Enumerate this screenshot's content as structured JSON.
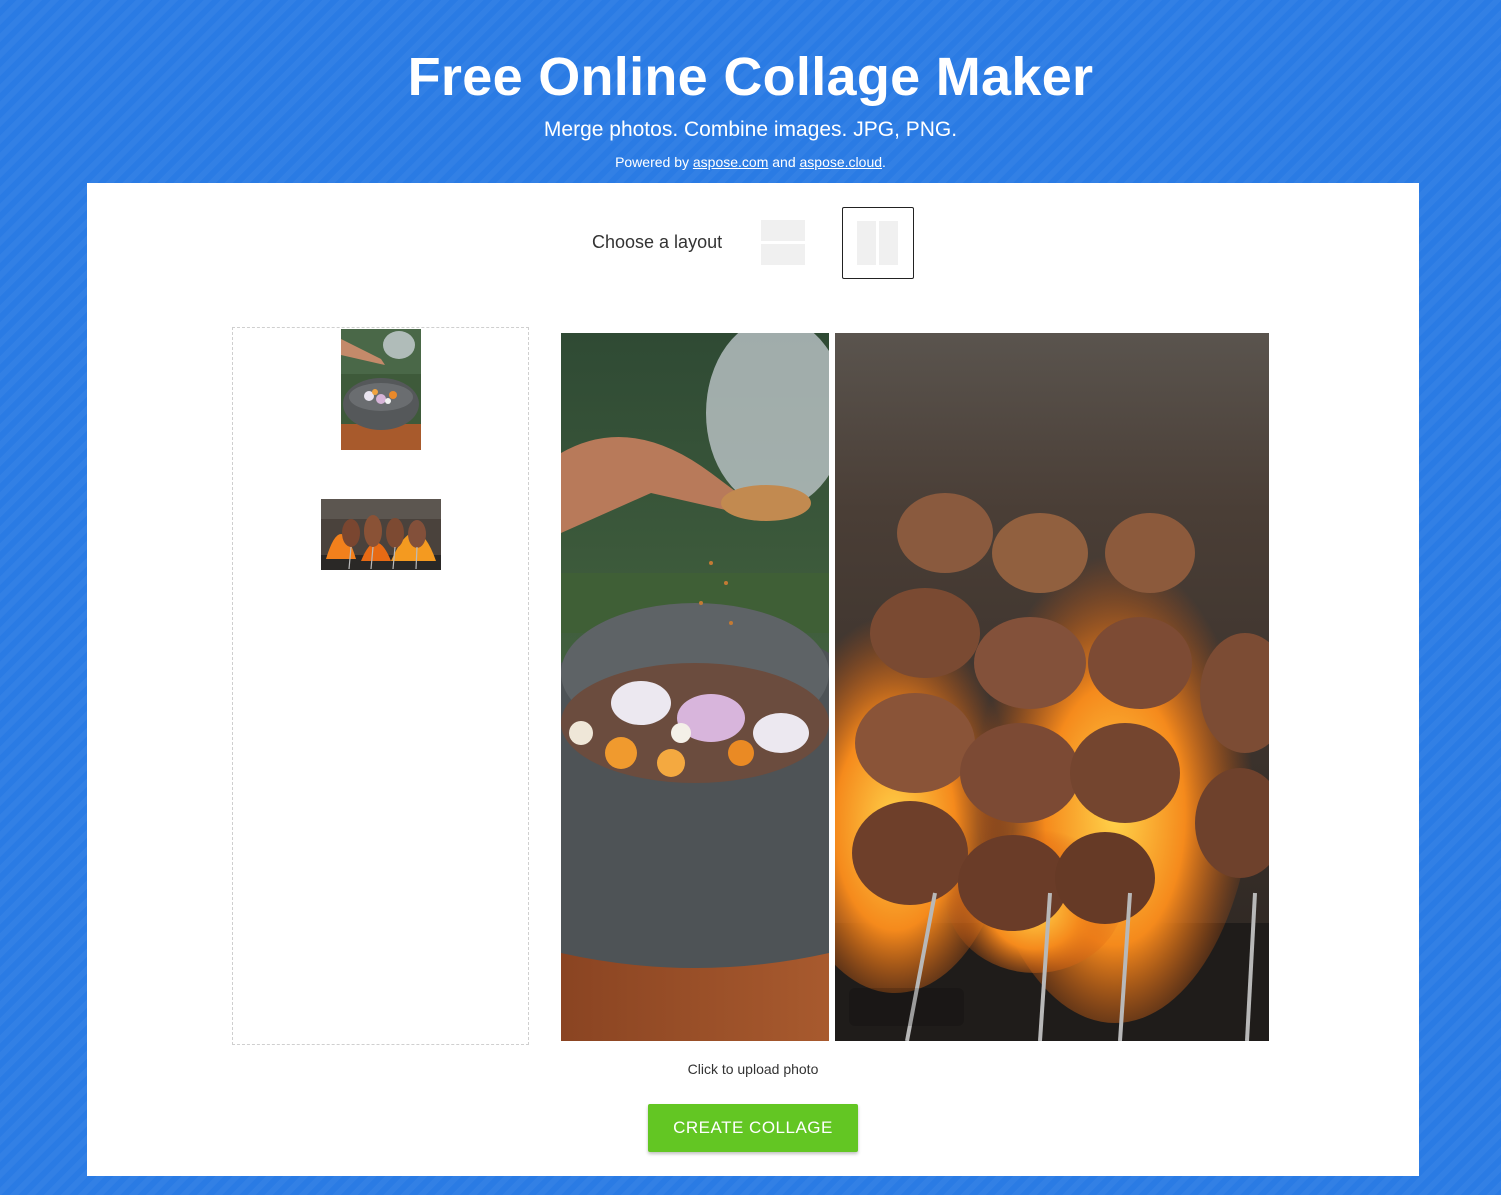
{
  "header": {
    "title": "Free Online Collage Maker",
    "subtitle": "Merge photos. Combine images. JPG, PNG.",
    "powered_prefix": "Powered by",
    "link1": "aspose.com",
    "and": "and",
    "link2": "aspose.cloud",
    "period": "."
  },
  "layout": {
    "label": "Choose a layout",
    "selected": "two-columns"
  },
  "thumbnails": [
    {
      "name": "spices-bowl-photo"
    },
    {
      "name": "grill-skewers-photo"
    }
  ],
  "collage": {
    "left_photo": "spices-bowl-photo",
    "right_photo": "grill-skewers-photo"
  },
  "upload_hint": "Click to upload photo",
  "create_button": "CREATE COLLAGE",
  "colors": {
    "background": "#2a7be4",
    "button": "#63c623"
  }
}
